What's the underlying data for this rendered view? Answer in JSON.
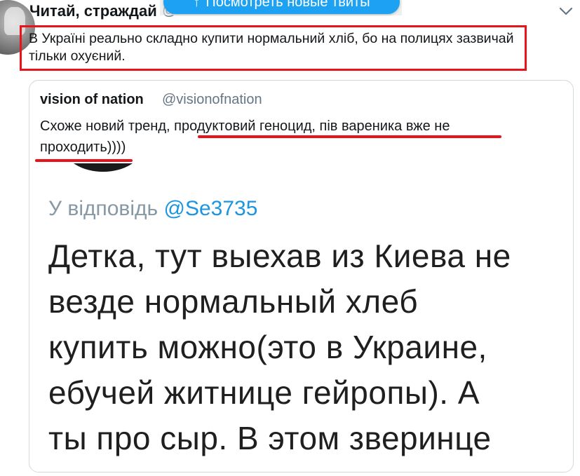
{
  "tweet": {
    "author_name": "Читай, страждай",
    "author_handle": "@",
    "text": "В Україні реально складно купити нормальний хліб, бо на полицях зазвичай тільки охуєний."
  },
  "new_tweets_pill": {
    "arrow": "↑",
    "label": "Посмотреть новые твиты",
    "color": "#1da1f2"
  },
  "quoted_tweet": {
    "author_name": "vision of nation",
    "author_handle": "@visionofnation",
    "text_plain": "Схоже новий тренд, ",
    "text_underlined_1": "продуктовий геноцид, пів вареника вже не",
    "text_underlined_2": "проходить))))",
    "highlight_color": "#e8141c"
  },
  "media": {
    "reply_prefix": "У відповідь ",
    "reply_mention": "@Se3735",
    "body_lines": [
      "Детка, тут выехав из Киева не",
      "везде нормальный хлеб",
      "купить можно(это в Украине,",
      "ебучей житнице гейропы). А",
      "ты про сыр. В этом зверинце"
    ]
  },
  "icons": {
    "caret": "chevron-down-icon",
    "avatar": "avatar"
  }
}
